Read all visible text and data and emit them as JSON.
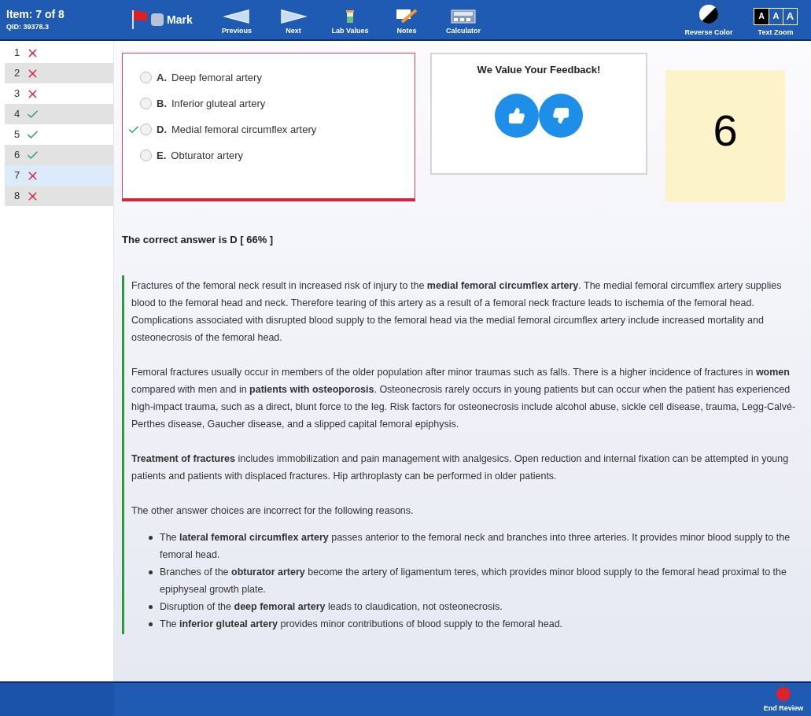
{
  "header": {
    "item": "Item: 7 of 8",
    "qid": "QID: 39378.3",
    "mark": {
      "label": "Mark",
      "checked": false
    },
    "tools": [
      {
        "kind": "previous",
        "label": "Previous"
      },
      {
        "kind": "next",
        "label": "Next"
      },
      {
        "kind": "lab",
        "label": "Lab Values"
      },
      {
        "kind": "notes",
        "label": "Notes"
      },
      {
        "kind": "calculator",
        "label": "Calculator"
      }
    ],
    "reverse_color": {
      "label": "Reverse Color"
    },
    "text_zoom": {
      "label": "Text Zoom",
      "sizes": [
        {
          "label": "A",
          "selected": true
        },
        {
          "label": "A",
          "selected": false
        },
        {
          "label": "A",
          "selected": false
        }
      ]
    }
  },
  "sidebar": {
    "items": [
      {
        "number": "1",
        "kind": "incorrect",
        "selected": false
      },
      {
        "number": "2",
        "kind": "incorrect",
        "selected": false
      },
      {
        "number": "3",
        "kind": "incorrect",
        "selected": false
      },
      {
        "number": "4",
        "kind": "correct",
        "selected": false
      },
      {
        "number": "5",
        "kind": "correct",
        "selected": false
      },
      {
        "number": "6",
        "kind": "correct",
        "selected": false
      },
      {
        "number": "7",
        "kind": "incorrect",
        "selected": true
      },
      {
        "number": "8",
        "kind": "incorrect",
        "selected": false
      }
    ]
  },
  "choices": [
    {
      "letter": "A.",
      "text": "Deep femoral artery",
      "correct": false,
      "selected": false
    },
    {
      "letter": "B.",
      "text": "Inferior gluteal artery",
      "correct": false,
      "selected": false
    },
    {
      "letter": "D.",
      "text": "Medial femoral circumflex artery",
      "correct": true,
      "selected": false
    },
    {
      "letter": "E.",
      "text": "Obturator artery",
      "correct": false,
      "selected": false
    }
  ],
  "feedback": {
    "title": "We Value Your Feedback!"
  },
  "note": {
    "text": "6"
  },
  "answer_summary": "The correct answer is D [ 66% ]",
  "explanation": {
    "paragraphs": [
      "Fractures of the femoral neck result in increased risk of injury to the **medial femoral circumflex artery**. The medial femoral circumflex artery supplies blood to the femoral head and neck. Therefore tearing of this artery as a result of a femoral neck fracture leads to ischemia of the femoral head. Complications associated with disrupted blood supply to the femoral head via the medial femoral circumflex artery include increased mortality and osteonecrosis of the femoral head.",
      "Femoral fractures usually occur in members of the older population after minor traumas such as falls. There is a higher incidence of fractures in **women** compared with men and in **patients with osteoporosis**. Osteonecrosis rarely occurs in young patients but can occur when the patient has experienced high-impact trauma, such as a direct, blunt force to the leg. Risk factors for osteonecrosis include alcohol abuse, sickle cell disease, trauma, Legg-Calvé-Perthes disease, Gaucher disease, and a slipped capital femoral epiphysis.",
      "**Treatment of fractures** includes immobilization and pain management with analgesics. Open reduction and internal fixation can be attempted in young patients and patients with displaced fractures. Hip arthroplasty can be performed in older patients.",
      "The other answer choices are incorrect for the following reasons."
    ],
    "bullets": [
      "The **lateral femoral circumflex artery** passes anterior to the femoral neck and branches into three arteries. It provides minor blood supply to the femoral head.",
      "Branches of the **obturator artery** become the artery of ligamentum teres, which provides minor blood supply to the femoral head proximal to the epiphyseal growth plate.",
      "Disruption of the **deep femoral artery** leads to claudication, not osteonecrosis.",
      "The **inferior gluteal artery** provides minor contributions of blood supply to the femoral head."
    ]
  },
  "footer": {
    "end_review": "End Review"
  }
}
